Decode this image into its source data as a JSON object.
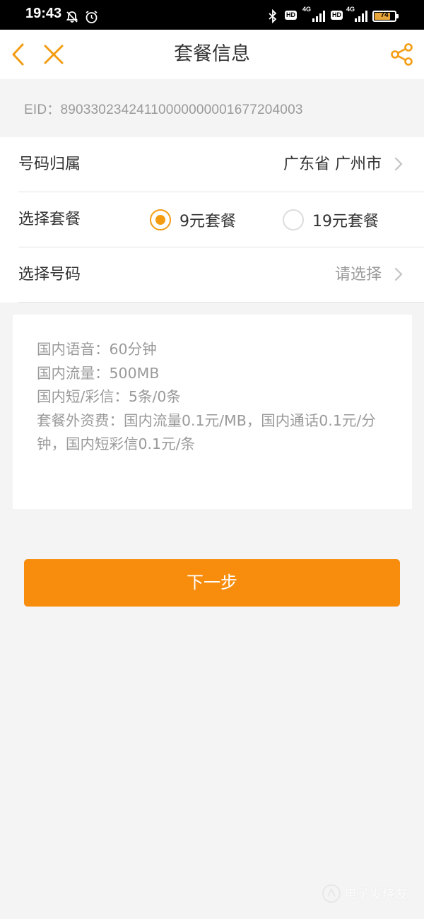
{
  "status_bar": {
    "time": "19:43",
    "hd_label": "HD",
    "network_label": "4G",
    "battery_level": "74",
    "icons": [
      "notifications-off-icon",
      "alarm-icon",
      "bluetooth-icon",
      "signal-icon",
      "battery-icon"
    ]
  },
  "nav": {
    "title": "套餐信息",
    "back_icon": "chevron-left-icon",
    "close_icon": "close-icon",
    "share_icon": "share-icon",
    "accent_color": "#f39c12"
  },
  "eid": "EID：89033023424110000000001677204003",
  "form": {
    "number_location": {
      "label": "号码归属",
      "value": "广东省 广州市"
    },
    "plan": {
      "label": "选择套餐",
      "options": [
        {
          "label": "9元套餐",
          "selected": true
        },
        {
          "label": "19元套餐",
          "selected": false
        }
      ]
    },
    "number": {
      "label": "选择号码",
      "placeholder": "请选择"
    }
  },
  "plan_details": [
    "国内语音：60分钟",
    "国内流量：500MB",
    "国内短/彩信：5条/0条",
    "套餐外资费：国内流量0.1元/MB，国内通话0.1元/分钟，国内短彩信0.1元/条"
  ],
  "next_button": {
    "label": "下一步",
    "color": "#f78c0d"
  },
  "watermark": "电子发烧友"
}
